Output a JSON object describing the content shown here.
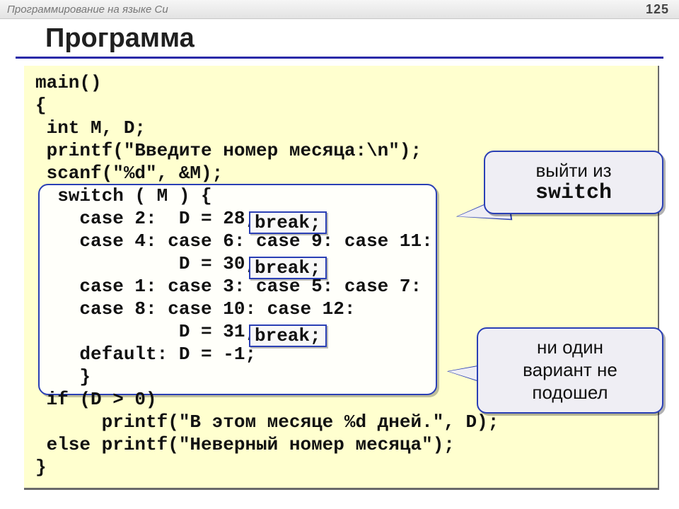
{
  "topbar": {
    "course": "Программирование на языке Си",
    "page": "125"
  },
  "title": "Программа",
  "code": {
    "line1": "main()",
    "line2": "{",
    "line3": " int M, D;",
    "line4": " printf(\"Введите номер месяца:\\n\");",
    "line5": " scanf(\"%d\", &M);",
    "line6": "  switch ( M ) {",
    "line7": "    case 2:  D = 28;",
    "line8": "    case 4: case 6: case 9: case 11:",
    "line9": "             D = 30;",
    "line10": "    case 1: case 3: case 5: case 7:",
    "line11": "    case 8: case 10: case 12:",
    "line12": "             D = 31;",
    "line13": "    default: D = -1;",
    "line14": "    }",
    "line15": " if (D > 0)",
    "line16": "      printf(\"В этом месяце %d дней.\", D);",
    "line17": " else printf(\"Неверный номер месяца\");",
    "line18": "}"
  },
  "break_label": "break;",
  "callouts": {
    "exit_switch_line1": "выйти из",
    "exit_switch_line2": "switch",
    "no_match_line1": "ни один",
    "no_match_line2": "вариант не",
    "no_match_line3": "подошел"
  }
}
